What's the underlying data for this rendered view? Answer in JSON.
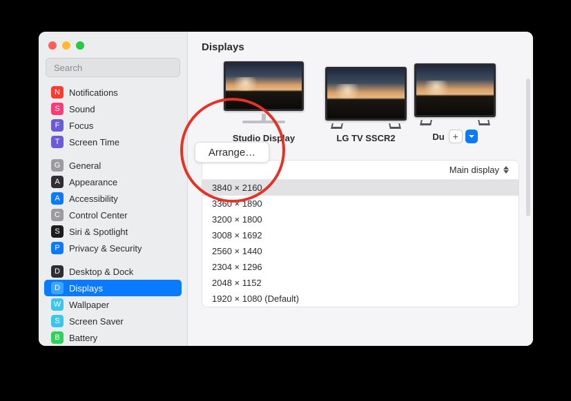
{
  "title": "Displays",
  "search": {
    "placeholder": "Search"
  },
  "sidebar": {
    "groups": [
      [
        {
          "label": "Notifications",
          "icon_bg": "#ff3b30",
          "glyph": "N"
        },
        {
          "label": "Sound",
          "icon_bg": "#ff3b77",
          "glyph": "S"
        },
        {
          "label": "Focus",
          "icon_bg": "#6a5bd9",
          "glyph": "F"
        },
        {
          "label": "Screen Time",
          "icon_bg": "#6a5bd9",
          "glyph": "T"
        }
      ],
      [
        {
          "label": "General",
          "icon_bg": "#9b9ba0",
          "glyph": "G"
        },
        {
          "label": "Appearance",
          "icon_bg": "#2e2e33",
          "glyph": "A"
        },
        {
          "label": "Accessibility",
          "icon_bg": "#0a7aff",
          "glyph": "A"
        },
        {
          "label": "Control Center",
          "icon_bg": "#9b9ba0",
          "glyph": "C"
        },
        {
          "label": "Siri & Spotlight",
          "icon_bg": "#1c1c1e",
          "glyph": "S"
        },
        {
          "label": "Privacy & Security",
          "icon_bg": "#0a7aff",
          "glyph": "P"
        }
      ],
      [
        {
          "label": "Desktop & Dock",
          "icon_bg": "#2e2e33",
          "glyph": "D"
        },
        {
          "label": "Displays",
          "icon_bg": "#3aa7ff",
          "glyph": "D",
          "selected": true
        },
        {
          "label": "Wallpaper",
          "icon_bg": "#3ac6ef",
          "glyph": "W"
        },
        {
          "label": "Screen Saver",
          "icon_bg": "#3ac6ef",
          "glyph": "S"
        },
        {
          "label": "Battery",
          "icon_bg": "#30d158",
          "glyph": "B"
        }
      ]
    ]
  },
  "displays": {
    "arrange_label": "Arrange…",
    "items": [
      {
        "name": "Studio Display",
        "type": "studio"
      },
      {
        "name": "LG TV SSCR2",
        "type": "tv"
      },
      {
        "name": "Du",
        "type": "tv_partial"
      }
    ],
    "add_button_label": "+"
  },
  "panel": {
    "role_selector": "Main display",
    "resolutions": [
      {
        "label": "3840 × 2160",
        "selected": true
      },
      {
        "label": "3360 × 1890"
      },
      {
        "label": "3200 × 1800"
      },
      {
        "label": "3008 × 1692"
      },
      {
        "label": "2560 × 1440"
      },
      {
        "label": "2304 × 1296"
      },
      {
        "label": "2048 × 1152"
      },
      {
        "label": "1920 × 1080 (Default)"
      }
    ]
  }
}
